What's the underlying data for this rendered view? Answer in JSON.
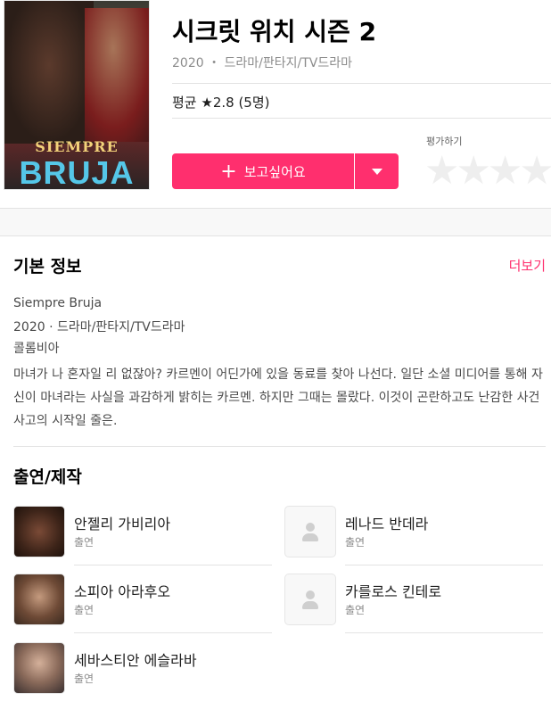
{
  "header": {
    "title": "시크릿 위치 시즌 2",
    "meta": "2020 ・ 드라마/판타지/TV드라마",
    "average": "평균 ★2.8 (5명)",
    "want_label": "보고싶어요",
    "rate_label": "평가하기",
    "poster": {
      "line1": "SIEMPRE",
      "line2": "BRUJA"
    }
  },
  "basic_info": {
    "heading": "기본 정보",
    "more_label": "더보기",
    "original_title": "Siempre Bruja",
    "year_genre": "2020 · 드라마/판타지/TV드라마",
    "country": "콜롬비아",
    "description": "마녀가 나 혼자일 리 없잖아? 카르멘이 어딘가에 있을 동료를 찾아 나선다. 일단 소셜 미디어를 통해 자신이 마녀라는 사실을 과감하게 밝히는 카르멘. 하지만 그때는 몰랐다. 이것이 곤란하고도 난감한 사건 사고의 시작일 줄은."
  },
  "cast": {
    "heading": "출연/제작",
    "items": [
      {
        "name": "안젤리 가비리아",
        "role": "출연"
      },
      {
        "name": "레나드 반데라",
        "role": "출연"
      },
      {
        "name": "소피아 아라후오",
        "role": "출연"
      },
      {
        "name": "카를로스 킨테로",
        "role": "출연"
      },
      {
        "name": "세바스티안 에슬라바",
        "role": "출연"
      }
    ]
  },
  "colors": {
    "accent": "#ff2f6e",
    "star_empty": "#eeeeee"
  }
}
